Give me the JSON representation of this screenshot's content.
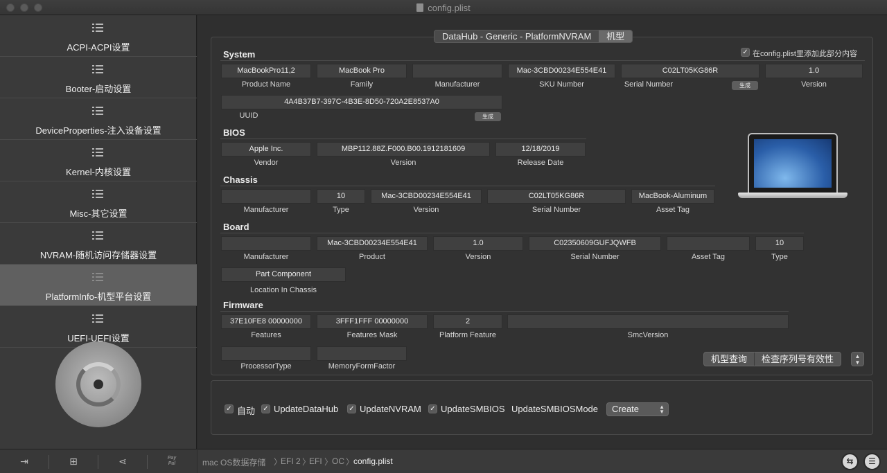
{
  "window": {
    "title": "config.plist"
  },
  "sidebar": {
    "items": [
      {
        "label": "ACPI-ACPI设置"
      },
      {
        "label": "Booter-启动设置"
      },
      {
        "label": "DeviceProperties-注入设备设置"
      },
      {
        "label": "Kernel-内核设置"
      },
      {
        "label": "Misc-其它设置"
      },
      {
        "label": "NVRAM-随机访问存储器设置"
      },
      {
        "label": "PlatformInfo-机型平台设置"
      },
      {
        "label": "UEFI-UEFI设置"
      }
    ],
    "bottom": {
      "paypal_line1": "Pay",
      "paypal_line2": "Pal"
    }
  },
  "tabs": {
    "generic": "DataHub  -  Generic  -  PlatformNVRAM",
    "model": "机型"
  },
  "header": {
    "add_to_config_label": "在config.plist里添加此部分内容",
    "add_to_config_checked": true
  },
  "system": {
    "title": "System",
    "product_name": {
      "value": "MacBookPro11,2",
      "label": "Product Name"
    },
    "family": {
      "value": "MacBook Pro",
      "label": "Family"
    },
    "manufacturer": {
      "value": "",
      "label": "Manufacturer"
    },
    "sku_number": {
      "value": "Mac-3CBD00234E554E41",
      "label": "SKU Number"
    },
    "serial_number": {
      "value": "C02LT05KG86R",
      "label": "Serial Number",
      "generate": "生成"
    },
    "version": {
      "value": "1.0",
      "label": "Version"
    },
    "uuid": {
      "value": "4A4B37B7-397C-4B3E-8D50-720A2E8537A0",
      "label": "UUID",
      "generate": "生成"
    }
  },
  "bios": {
    "title": "BIOS",
    "vendor": {
      "value": "Apple Inc.",
      "label": "Vendor"
    },
    "version": {
      "value": "MBP112.88Z.F000.B00.1912181609",
      "label": "Version"
    },
    "release_date": {
      "value": "12/18/2019",
      "label": "Release Date"
    }
  },
  "chassis": {
    "title": "Chassis",
    "manufacturer": {
      "value": "",
      "label": "Manufacturer"
    },
    "type": {
      "value": "10",
      "label": "Type"
    },
    "version": {
      "value": "Mac-3CBD00234E554E41",
      "label": "Version"
    },
    "serial_number": {
      "value": "C02LT05KG86R",
      "label": "Serial Number"
    },
    "asset_tag": {
      "value": "MacBook-Aluminum",
      "label": "Asset Tag"
    }
  },
  "board": {
    "title": "Board",
    "manufacturer": {
      "value": "",
      "label": "Manufacturer"
    },
    "product": {
      "value": "Mac-3CBD00234E554E41",
      "label": "Product"
    },
    "version": {
      "value": "1.0",
      "label": "Version"
    },
    "serial_number": {
      "value": "C02350609GUFJQWFB",
      "label": "Serial Number"
    },
    "asset_tag": {
      "value": "",
      "label": "Asset Tag"
    },
    "type": {
      "value": "10",
      "label": "Type"
    },
    "location": {
      "value": "Part Component",
      "label": "Location In Chassis"
    }
  },
  "firmware": {
    "title": "Firmware",
    "features": {
      "value": "37E10FE8 00000000",
      "label": "Features"
    },
    "features_mask": {
      "value": "3FFF1FFF 00000000",
      "label": "Features Mask"
    },
    "platform_feature": {
      "value": "2",
      "label": "Platform Feature"
    },
    "smc_version": {
      "value": "",
      "label": "SmcVersion"
    },
    "processor_type": {
      "value": "",
      "label": "ProcessorType"
    },
    "memory_form_factor": {
      "value": "",
      "label": "MemoryFormFactor"
    }
  },
  "actions": {
    "model_query": "机型查询",
    "check_serial": "检查序列号有效性"
  },
  "options": {
    "auto": {
      "label": "自动",
      "checked": true
    },
    "update_datahub": {
      "label": "UpdateDataHub",
      "checked": true
    },
    "update_nvram": {
      "label": "UpdateNVRAM",
      "checked": true
    },
    "update_smbios": {
      "label": "UpdateSMBIOS",
      "checked": true
    },
    "update_smbios_mode": {
      "label": "UpdateSMBIOSMode",
      "value": "Create"
    }
  },
  "breadcrumb": [
    "mac OS数据存储",
    "EFI 2",
    "EFI",
    "OC",
    "config.plist"
  ]
}
